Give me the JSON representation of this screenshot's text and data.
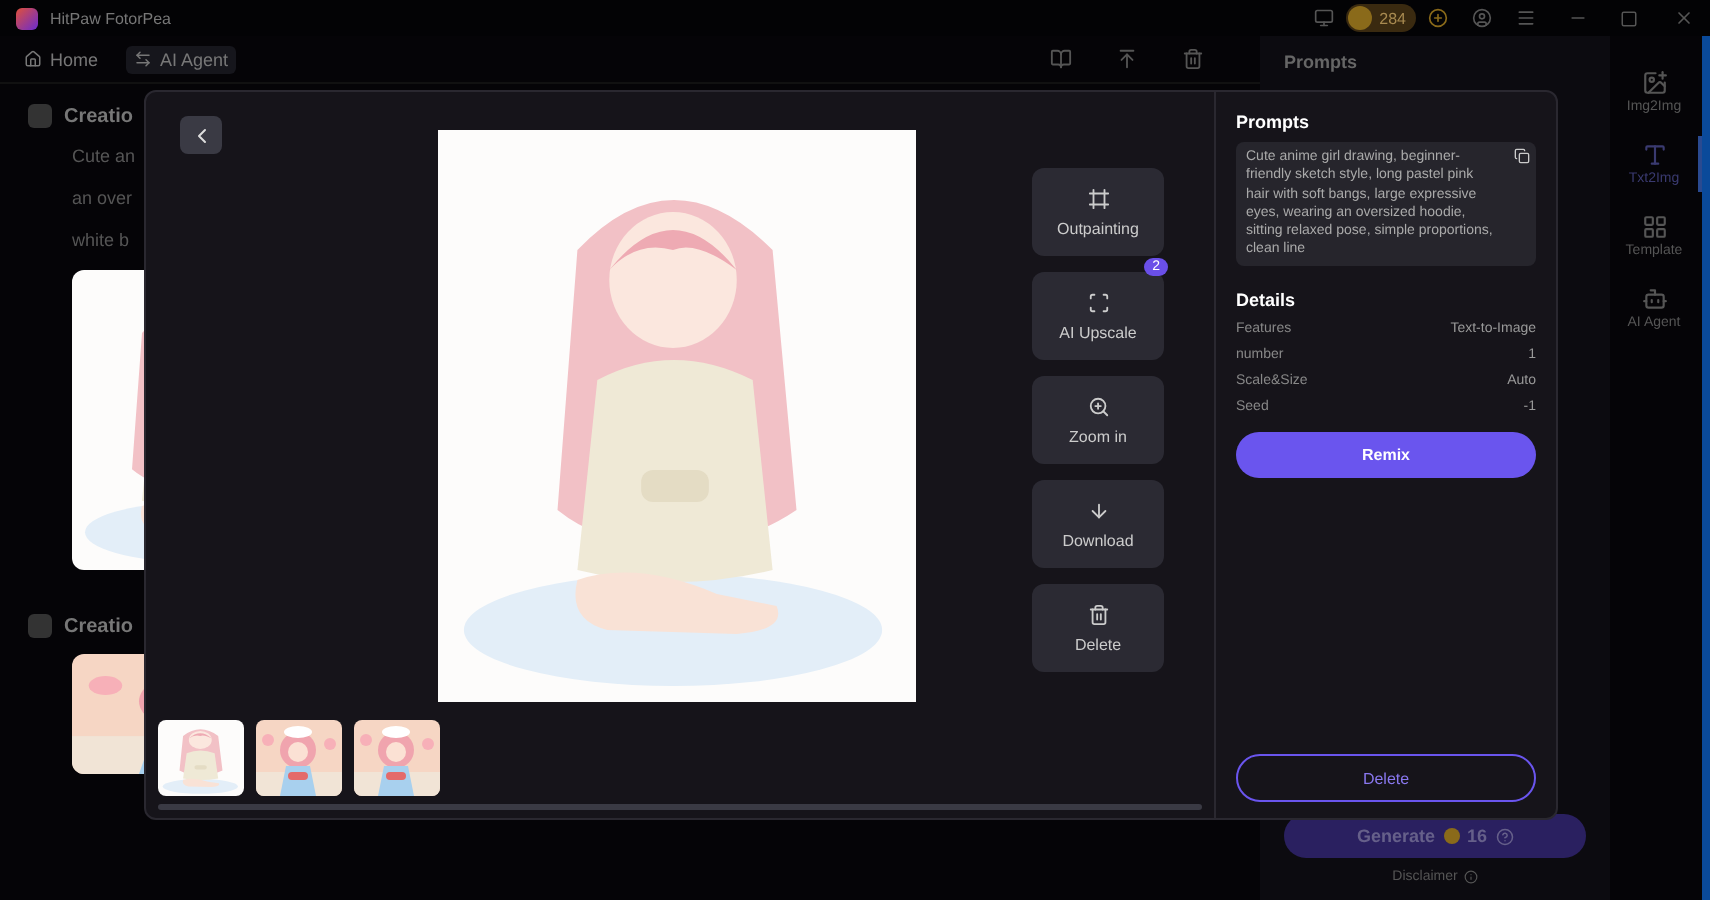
{
  "app": {
    "title": "HitPaw FotorPea",
    "coins": "284"
  },
  "nav": [
    {
      "label": "Home",
      "selected": false
    },
    {
      "label": "AI Agent",
      "selected": true
    }
  ],
  "feed": [
    {
      "title": "Creatio",
      "lines": [
        "Cute an",
        "an over",
        "white b"
      ]
    },
    {
      "title": "Creatio"
    }
  ],
  "side_panel": {
    "title": "Prompts",
    "generate": "Generate",
    "cost": "16",
    "disclaimer": "Disclaimer"
  },
  "sidebar": [
    {
      "label": "Img2Img",
      "selected": false
    },
    {
      "label": "Txt2Img",
      "selected": true
    },
    {
      "label": "Template",
      "selected": false
    },
    {
      "label": "AI Agent",
      "selected": false
    }
  ],
  "modal": {
    "tools": [
      {
        "kind": "outpaint",
        "label": "Outpainting"
      },
      {
        "kind": "upscale",
        "label": "AI Upscale",
        "badge": "2"
      },
      {
        "kind": "zoom",
        "label": "Zoom in"
      },
      {
        "kind": "download",
        "label": "Download"
      },
      {
        "kind": "delete",
        "label": "Delete"
      }
    ],
    "prompts_title": "Prompts",
    "prompt": "Cute anime girl drawing, beginner-friendly sketch style, long pastel pink hair with soft bangs, large expressive eyes, wearing an oversized hoodie, sitting relaxed pose, simple proportions, clean line",
    "details_title": "Details",
    "details": [
      {
        "label": "Features",
        "value": "Text-to-Image"
      },
      {
        "label": "number",
        "value": "1"
      },
      {
        "label": "Scale&Size",
        "value": "Auto"
      },
      {
        "label": "Seed",
        "value": "-1"
      }
    ],
    "remix": "Remix",
    "delete": "Delete",
    "thumbnails": [
      {
        "kind": "sketch"
      },
      {
        "kind": "chef"
      },
      {
        "kind": "chef"
      }
    ]
  }
}
